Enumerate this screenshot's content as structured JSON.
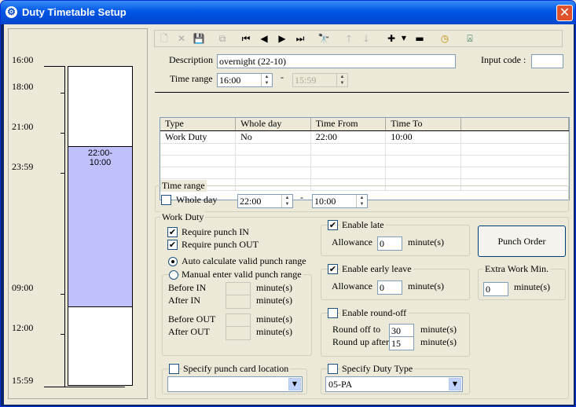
{
  "window": {
    "title": "Duty Timetable Setup",
    "close_symbol": "✕"
  },
  "timeline": {
    "hour_labels": [
      "16:00",
      "18:00",
      "21:00",
      "23:59",
      "09:00",
      "12:00",
      "15:59"
    ],
    "block_label": "22:00-\n10:00",
    "block_color": "#c0c0fc"
  },
  "toolbar": {
    "icons": [
      "new-icon",
      "delete-icon",
      "save-icon",
      "copy-icon",
      "first-icon",
      "prev-icon",
      "next-icon",
      "last-icon",
      "find-icon",
      "up-arrow-icon",
      "down-arrow-icon",
      "add-icon",
      "remove-icon",
      "clock-icon",
      "exit-icon"
    ]
  },
  "header": {
    "description_label": "Description",
    "description_value": "overnight (22-10)",
    "input_code_label": "Input code :",
    "input_code_value": "",
    "time_range_label": "Time range",
    "time_from": "16:00",
    "time_sep": "-",
    "time_to": "15:59"
  },
  "grid": {
    "columns": [
      "Type",
      "Whole day",
      "Time From",
      "Time To"
    ],
    "rows": [
      [
        "Work Duty",
        "No",
        "22:00",
        "10:00"
      ]
    ]
  },
  "time_range_group": {
    "title": "Time range",
    "whole_day_label": "Whole day",
    "whole_day_checked": false,
    "from": "22:00",
    "sep": "-",
    "to": "10:00"
  },
  "work_duty": {
    "title": "Work Duty",
    "require_in_label": "Require punch IN",
    "require_out_label": "Require punch OUT",
    "auto_calc_label": "Auto calculate valid punch range",
    "manual_label": "Manual enter valid punch range",
    "before_in_label": "Before IN",
    "after_in_label": "After IN",
    "before_out_label": "Before OUT",
    "after_out_label": "After OUT",
    "minute_unit": "minute(s)",
    "specify_location_label": "Specify punch card location",
    "location_value": "",
    "enable_late_label": "Enable late",
    "late_allowance_label": "Allowance",
    "late_allowance_value": "0",
    "enable_early_label": "Enable early leave",
    "early_allowance_label": "Allowance",
    "early_allowance_value": "0",
    "enable_roundoff_label": "Enable round-off",
    "round_off_label": "Round off to",
    "round_off_value": "30",
    "round_up_label": "Round up after",
    "round_up_value": "15",
    "specify_duty_type_label": "Specify Duty Type",
    "duty_type_value": "05-PA",
    "punch_order_label": "Punch Order",
    "extra_work_title": "Extra Work Min.",
    "extra_work_value": "0",
    "check_mark": "✔"
  }
}
